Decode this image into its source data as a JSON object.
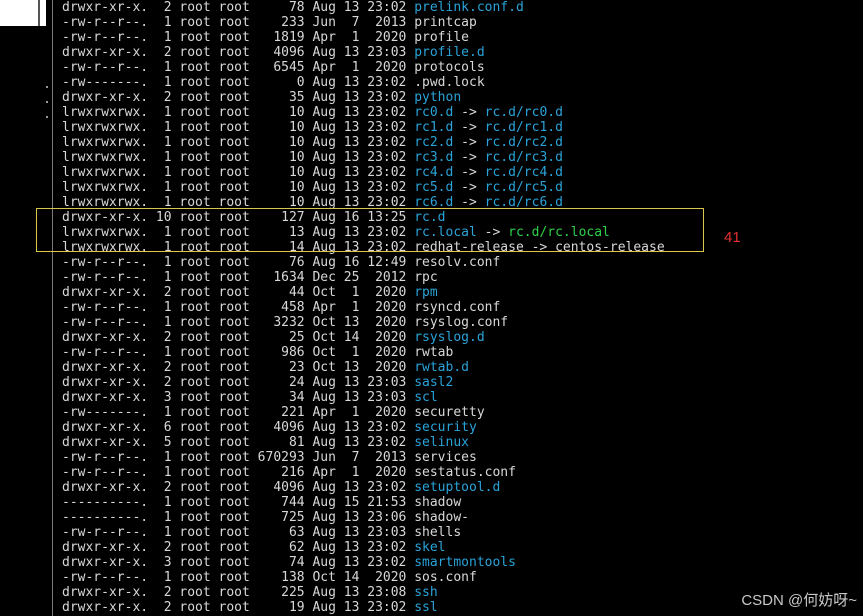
{
  "annotation": {
    "label": "41",
    "color": "#e03030"
  },
  "watermark": "CSDN @何妨呀~",
  "colors": {
    "background": "#000000",
    "text": "#d8d8d8",
    "dir": "#2aa3d8",
    "green_target": "#2ed14a",
    "box": "#d9c64a"
  },
  "rows": [
    {
      "meta": "drwxr-xr-x.  2 root root     78 Aug 13 23:02 ",
      "name": "prelink.conf.d",
      "kind": "dir"
    },
    {
      "meta": "-rw-r--r--.  1 root root    233 Jun  7  2013 ",
      "name": "printcap",
      "kind": "file"
    },
    {
      "meta": "-rw-r--r--.  1 root root   1819 Apr  1  2020 ",
      "name": "profile",
      "kind": "file"
    },
    {
      "meta": "drwxr-xr-x.  2 root root   4096 Aug 13 23:03 ",
      "name": "profile.d",
      "kind": "dir"
    },
    {
      "meta": "-rw-r--r--.  1 root root   6545 Apr  1  2020 ",
      "name": "protocols",
      "kind": "file"
    },
    {
      "meta": "-rw-------.  1 root root      0 Aug 13 23:02 ",
      "name": ".pwd.lock",
      "kind": "file"
    },
    {
      "meta": "drwxr-xr-x.  2 root root     35 Aug 13 23:02 ",
      "name": "python",
      "kind": "dir"
    },
    {
      "meta": "lrwxrwxrwx.  1 root root     10 Aug 13 23:02 ",
      "name": "rc0.d",
      "arrow": " -> ",
      "target": "rc.d/rc0.d",
      "kind": "link"
    },
    {
      "meta": "lrwxrwxrwx.  1 root root     10 Aug 13 23:02 ",
      "name": "rc1.d",
      "arrow": " -> ",
      "target": "rc.d/rc1.d",
      "kind": "link"
    },
    {
      "meta": "lrwxrwxrwx.  1 root root     10 Aug 13 23:02 ",
      "name": "rc2.d",
      "arrow": " -> ",
      "target": "rc.d/rc2.d",
      "kind": "link"
    },
    {
      "meta": "lrwxrwxrwx.  1 root root     10 Aug 13 23:02 ",
      "name": "rc3.d",
      "arrow": " -> ",
      "target": "rc.d/rc3.d",
      "kind": "link"
    },
    {
      "meta": "lrwxrwxrwx.  1 root root     10 Aug 13 23:02 ",
      "name": "rc4.d",
      "arrow": " -> ",
      "target": "rc.d/rc4.d",
      "kind": "link"
    },
    {
      "meta": "lrwxrwxrwx.  1 root root     10 Aug 13 23:02 ",
      "name": "rc5.d",
      "arrow": " -> ",
      "target": "rc.d/rc5.d",
      "kind": "link"
    },
    {
      "meta": "lrwxrwxrwx.  1 root root     10 Aug 13 23:02 ",
      "name": "rc6.d",
      "arrow": " -> ",
      "target": "rc.d/rc6.d",
      "kind": "link"
    },
    {
      "meta": "drwxr-xr-x. 10 root root    127 Aug 16 13:25 ",
      "name": "rc.d",
      "kind": "dir"
    },
    {
      "meta": "lrwxrwxrwx.  1 root root     13 Aug 13 23:02 ",
      "name": "rc.local",
      "arrow": " -> ",
      "target": "rc.d/rc.local",
      "kind": "link-green"
    },
    {
      "meta": "lrwxrwxrwx.  1 root root     14 Aug 13 23:02 ",
      "name": "redhat-release",
      "arrow": " -> ",
      "target": "centos-release",
      "kind": "link-plain"
    },
    {
      "meta": "-rw-r--r--.  1 root root     76 Aug 16 12:49 ",
      "name": "resolv.conf",
      "kind": "file"
    },
    {
      "meta": "-rw-r--r--.  1 root root   1634 Dec 25  2012 ",
      "name": "rpc",
      "kind": "file"
    },
    {
      "meta": "drwxr-xr-x.  2 root root     44 Oct  1  2020 ",
      "name": "rpm",
      "kind": "dir"
    },
    {
      "meta": "-rw-r--r--.  1 root root    458 Apr  1  2020 ",
      "name": "rsyncd.conf",
      "kind": "file"
    },
    {
      "meta": "-rw-r--r--.  1 root root   3232 Oct 13  2020 ",
      "name": "rsyslog.conf",
      "kind": "file"
    },
    {
      "meta": "drwxr-xr-x.  2 root root     25 Oct 14  2020 ",
      "name": "rsyslog.d",
      "kind": "dir"
    },
    {
      "meta": "-rw-r--r--.  1 root root    986 Oct  1  2020 ",
      "name": "rwtab",
      "kind": "file"
    },
    {
      "meta": "drwxr-xr-x.  2 root root     23 Oct 13  2020 ",
      "name": "rwtab.d",
      "kind": "dir"
    },
    {
      "meta": "drwxr-xr-x.  2 root root     24 Aug 13 23:03 ",
      "name": "sasl2",
      "kind": "dir"
    },
    {
      "meta": "drwxr-xr-x.  3 root root     34 Aug 13 23:03 ",
      "name": "scl",
      "kind": "dir"
    },
    {
      "meta": "-rw-------.  1 root root    221 Apr  1  2020 ",
      "name": "securetty",
      "kind": "file"
    },
    {
      "meta": "drwxr-xr-x.  6 root root   4096 Aug 13 23:02 ",
      "name": "security",
      "kind": "dir"
    },
    {
      "meta": "drwxr-xr-x.  5 root root     81 Aug 13 23:02 ",
      "name": "selinux",
      "kind": "dir"
    },
    {
      "meta": "-rw-r--r--.  1 root root 670293 Jun  7  2013 ",
      "name": "services",
      "kind": "file"
    },
    {
      "meta": "-rw-r--r--.  1 root root    216 Apr  1  2020 ",
      "name": "sestatus.conf",
      "kind": "file"
    },
    {
      "meta": "drwxr-xr-x.  2 root root   4096 Aug 13 23:02 ",
      "name": "setuptool.d",
      "kind": "dir"
    },
    {
      "meta": "----------.  1 root root    744 Aug 15 21:53 ",
      "name": "shadow",
      "kind": "file"
    },
    {
      "meta": "----------.  1 root root    725 Aug 13 23:06 ",
      "name": "shadow-",
      "kind": "file"
    },
    {
      "meta": "-rw-r--r--.  1 root root     63 Aug 13 23:03 ",
      "name": "shells",
      "kind": "file"
    },
    {
      "meta": "drwxr-xr-x.  2 root root     62 Aug 13 23:02 ",
      "name": "skel",
      "kind": "dir"
    },
    {
      "meta": "drwxr-xr-x.  3 root root     74 Aug 13 23:02 ",
      "name": "smartmontools",
      "kind": "dir"
    },
    {
      "meta": "-rw-r--r--.  1 root root    138 Oct 14  2020 ",
      "name": "sos.conf",
      "kind": "file"
    },
    {
      "meta": "drwxr-xr-x.  2 root root    225 Aug 13 23:08 ",
      "name": "ssh",
      "kind": "dir"
    },
    {
      "meta": "drwxr-xr-x.  2 root root     19 Aug 13 23:02 ",
      "name": "ssl",
      "kind": "dir"
    }
  ]
}
